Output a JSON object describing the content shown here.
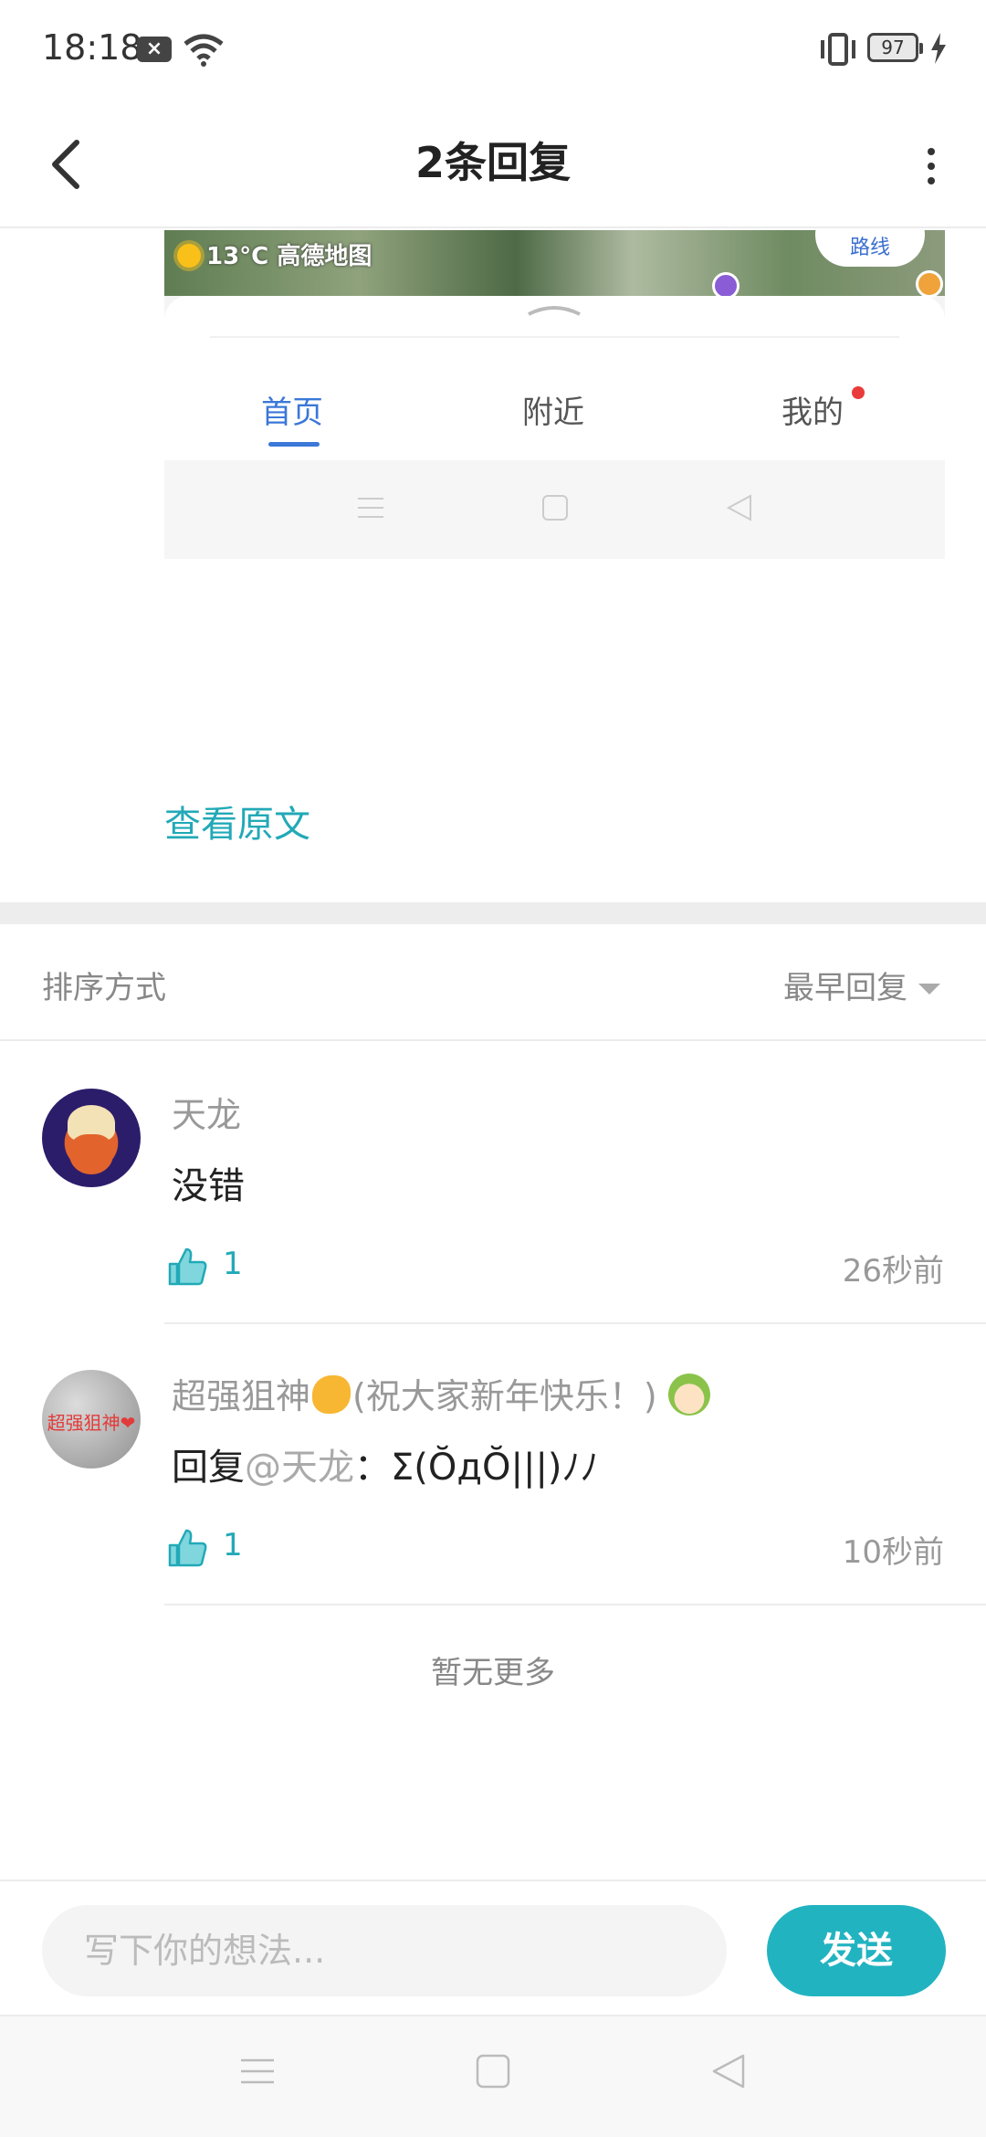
{
  "status_bar": {
    "time": "18:18",
    "battery": "97"
  },
  "header": {
    "title": "2条回复"
  },
  "embed": {
    "weather": "13°C",
    "map_brand": "高德地图",
    "route_label": "路线",
    "tabs": [
      {
        "label": "首页"
      },
      {
        "label": "附近"
      },
      {
        "label": "我的"
      }
    ]
  },
  "view_original": "查看原文",
  "sort": {
    "label": "排序方式",
    "selected": "最早回复"
  },
  "comments": [
    {
      "user": "天龙",
      "body": "没错",
      "likes": "1",
      "time": "26秒前"
    },
    {
      "user_prefix": "超强狙神",
      "user_suffix": "(祝大家新年快乐！)",
      "avatar_text": "超强狙神❤",
      "reply_word": "回复",
      "mention": "@天龙",
      "body": "：Σ(ŎдŎ|||)ﾉﾉ",
      "likes": "1",
      "time": "10秒前"
    }
  ],
  "no_more": "暂无更多",
  "composer": {
    "placeholder": "写下你的想法...",
    "send_label": "发送"
  },
  "colors": {
    "accent": "#22b3c1",
    "tab_active": "#3b78d8",
    "badge": "#ea3b3b"
  }
}
